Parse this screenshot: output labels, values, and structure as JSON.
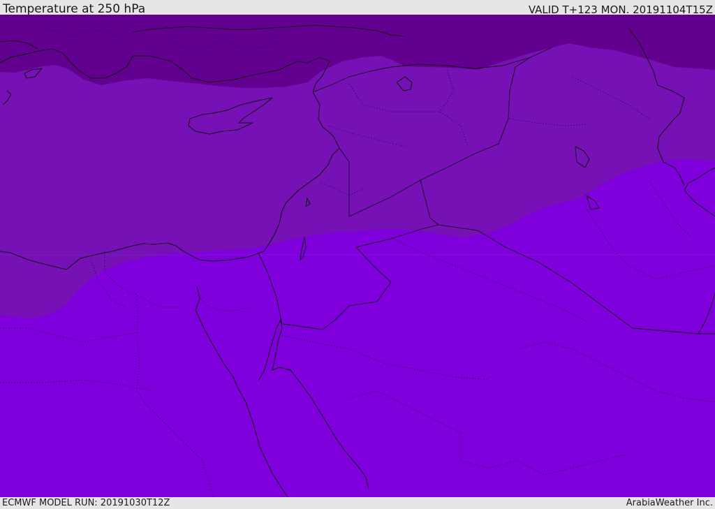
{
  "header": {
    "title": "Temperature at 250 hPa",
    "valid": "VALID T+123 MON. 20191104T15Z"
  },
  "footer": {
    "model_run": "ECMWF MODEL RUN: 20191030T12Z",
    "credit": "ArabiaWeather Inc."
  },
  "map": {
    "colors": {
      "band_cold": "#62008f",
      "band_mid": "#7511b5",
      "band_warm": "#7f00dc",
      "coast": "#111111"
    }
  }
}
